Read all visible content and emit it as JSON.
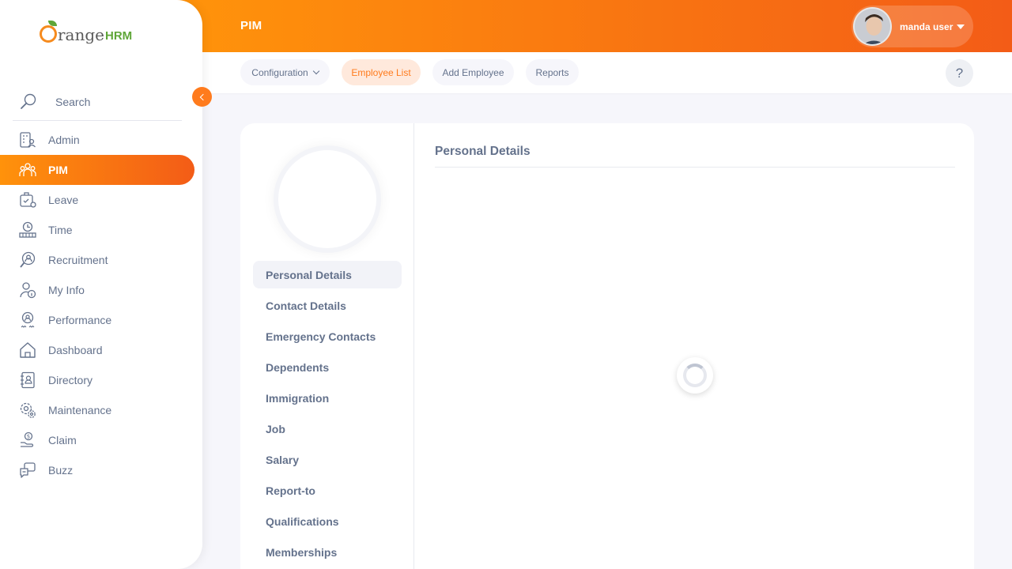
{
  "app": {
    "brand_main": "range",
    "brand_suffix": "HRM"
  },
  "header": {
    "module_title": "PIM",
    "user_name": "manda user"
  },
  "sidebar": {
    "search_label": "Search",
    "items": [
      {
        "label": "Admin",
        "icon": "admin-icon"
      },
      {
        "label": "PIM",
        "icon": "pim-icon",
        "active": true
      },
      {
        "label": "Leave",
        "icon": "leave-icon"
      },
      {
        "label": "Time",
        "icon": "time-icon"
      },
      {
        "label": "Recruitment",
        "icon": "recruitment-icon"
      },
      {
        "label": "My Info",
        "icon": "my-info-icon"
      },
      {
        "label": "Performance",
        "icon": "performance-icon"
      },
      {
        "label": "Dashboard",
        "icon": "dashboard-icon"
      },
      {
        "label": "Directory",
        "icon": "directory-icon"
      },
      {
        "label": "Maintenance",
        "icon": "maintenance-icon"
      },
      {
        "label": "Claim",
        "icon": "claim-icon"
      },
      {
        "label": "Buzz",
        "icon": "buzz-icon"
      }
    ]
  },
  "subnav": {
    "configuration": "Configuration",
    "employee_list": "Employee List",
    "add_employee": "Add Employee",
    "reports": "Reports",
    "help": "?"
  },
  "profile_tabs": [
    "Personal Details",
    "Contact Details",
    "Emergency Contacts",
    "Dependents",
    "Immigration",
    "Job",
    "Salary",
    "Report-to",
    "Qualifications",
    "Memberships"
  ],
  "main": {
    "section_title": "Personal Details"
  },
  "colors": {
    "accent": "#ff7b1d",
    "gradient_start": "#ff920b",
    "gradient_end": "#f35c17",
    "text": "#64728c"
  }
}
